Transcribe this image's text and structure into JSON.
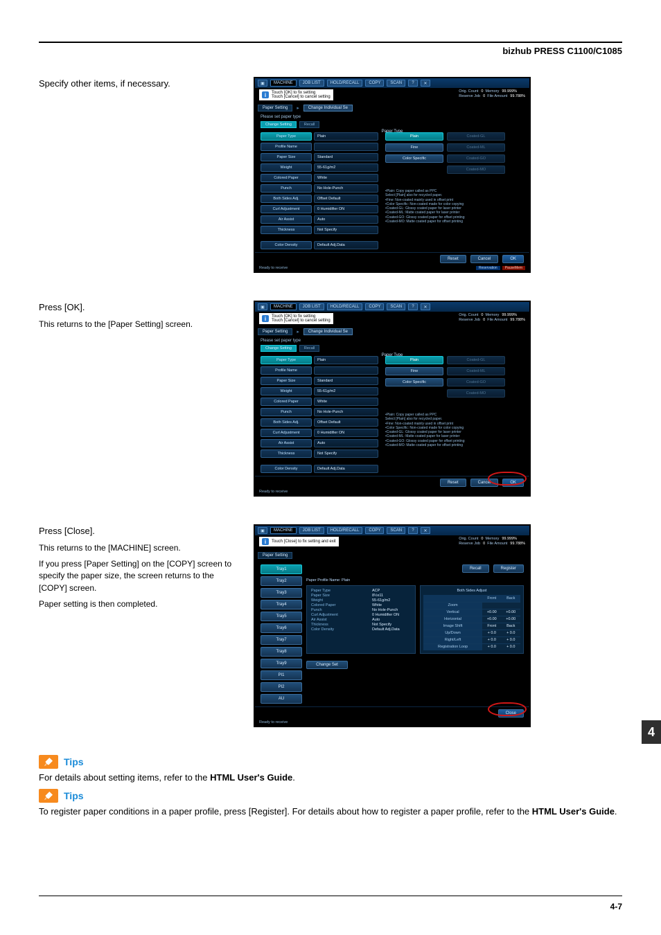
{
  "header": {
    "model": "bizhub PRESS C1100/C1085"
  },
  "steps": {
    "s1": {
      "lead": "Specify other items, if necessary."
    },
    "s2": {
      "lead": "Press [OK].",
      "sub1": "This returns to the [Paper Setting] screen."
    },
    "s3": {
      "lead": "Press [Close].",
      "sub1": "This returns to the [MACHINE] screen.",
      "sub2": "If you press [Paper Setting] on the [COPY] screen to specify the paper size, the screen returns to the [COPY] screen.",
      "sub3": "Paper setting is then completed."
    }
  },
  "shot": {
    "topbar": {
      "machine": "MACHINE",
      "joblist": "JOB LIST",
      "recall": "HOLD/RECALL",
      "copy": "COPY",
      "scan": "SCAN",
      "help": "?",
      "close": "✕"
    },
    "msg1": "Touch [OK] to fix setting\nTouch [Cancel] to cancel setting",
    "msg3": "Touch [Close] to fix setting and exit",
    "status": {
      "l1k": "Orig. Count",
      "l1v": "0",
      "l2k": "Reserve Job",
      "l2v": "0",
      "r1k": "Memory",
      "r1v": "99.999%",
      "r2k": "File Amount",
      "r2v": "99.788%"
    },
    "crumb1": "Paper Setting",
    "crumb2": "Change Individual Se",
    "subhdr": "Please set paper type",
    "subtab1": "Change Setting",
    "subtab2": "Recall",
    "sectitle": "Paper Type",
    "left": {
      "type": {
        "k": "Paper Type",
        "v": "Plain"
      },
      "profile": {
        "k": "Profile Name",
        "v": ""
      },
      "size": {
        "k": "Paper Size",
        "v": "Standard"
      },
      "weight": {
        "k": "Weight",
        "v": "55-61g/m2"
      },
      "colored": {
        "k": "Colored Paper",
        "v": "White"
      },
      "punch": {
        "k": "Punch",
        "v": "No Hole-Punch"
      },
      "both": {
        "k": "Both Sides Adj.",
        "v": "Offset Default"
      },
      "curl": {
        "k": "Curl Adjustment",
        "v": "0  Humidifier ON"
      },
      "air": {
        "k": "Air Assist",
        "v": "Auto"
      },
      "thick": {
        "k": "Thickness",
        "v": "Not Specify"
      },
      "color": {
        "k": "Color Density",
        "v": "Default Adj.Data"
      }
    },
    "right": {
      "plain": "Plain",
      "fine": "Fine",
      "colorspec": "Color Specific",
      "gl": "Coated-GL",
      "ml": "Coated-ML",
      "go": "Coated-GO",
      "mo": "Coated-MO"
    },
    "notes": "•Plain: Copy paper called as PPC\n Select [Plain] also for recycled paper.\n•Fine: Non-coated mainly used in offset print\n•Color Specific: Non-coated made for color copying\n•Coated-GL: Glossy coated paper for laser printer\n•Coated-ML: Matte coated paper for laser printer\n•Coated-GO: Glossy coated paper for offset printing\n•Coated-MO: Matte coated paper for offset printing",
    "foot": {
      "reset": "Reset",
      "cancel": "Cancel",
      "ok": "OK",
      "close": "Close"
    },
    "statusbar": {
      "left": "Ready to receive",
      "tag1": "Reservation",
      "tag2": "PauseMem"
    }
  },
  "shot3": {
    "trays": [
      "Tray1",
      "Tray2",
      "Tray3",
      "Tray4",
      "Tray5",
      "Tray6",
      "Tray7",
      "Tray8",
      "Tray9",
      "PI1",
      "PI2",
      "AU"
    ],
    "hdr": "Paper Profile Name: Plain",
    "details": [
      [
        "Paper Type",
        "ACP"
      ],
      [
        "Paper Size",
        "8½x11"
      ],
      [
        "Weight",
        "55-61g/m2"
      ],
      [
        "Colored Paper",
        "White"
      ],
      [
        "Punch",
        "No Hole-Punch"
      ],
      [
        "Curl Adjustment",
        "0  Humidifier ON"
      ],
      [
        "Air Assist",
        "Auto"
      ],
      [
        "Thickness",
        "Not Specify"
      ],
      [
        "Color Density",
        "Default Adj.Data"
      ]
    ],
    "adj": {
      "title": "Both Sides Adjust",
      "cols": [
        "",
        "Front",
        "Back"
      ],
      "rows": [
        [
          "Zoom",
          "",
          " ",
          " "
        ],
        [
          "Vertical",
          "+0.00",
          "+0.00"
        ],
        [
          "Horizontal",
          "+0.00",
          "+0.00"
        ],
        [
          "Image Shift",
          "Front",
          "Back"
        ],
        [
          "Up/Down",
          "+ 0.0",
          "+ 0.0"
        ],
        [
          "Right/Left",
          "+ 0.0",
          "+ 0.0"
        ],
        [
          "Registration Loop",
          "+ 0.0",
          "+ 0.0"
        ]
      ]
    },
    "recall": "Recall",
    "register": "Register",
    "changeset": "Change Set"
  },
  "tips": {
    "label": "Tips",
    "t1a": "For details about setting items, refer to the ",
    "t1b": "HTML User's Guide",
    "t1c": ".",
    "t2a": "To register paper conditions in a paper profile, press [Register]. For details about how to register a paper profile, refer to the ",
    "t2b": "HTML User's Guide",
    "t2c": "."
  },
  "chapter": "4",
  "pageno": "4-7"
}
